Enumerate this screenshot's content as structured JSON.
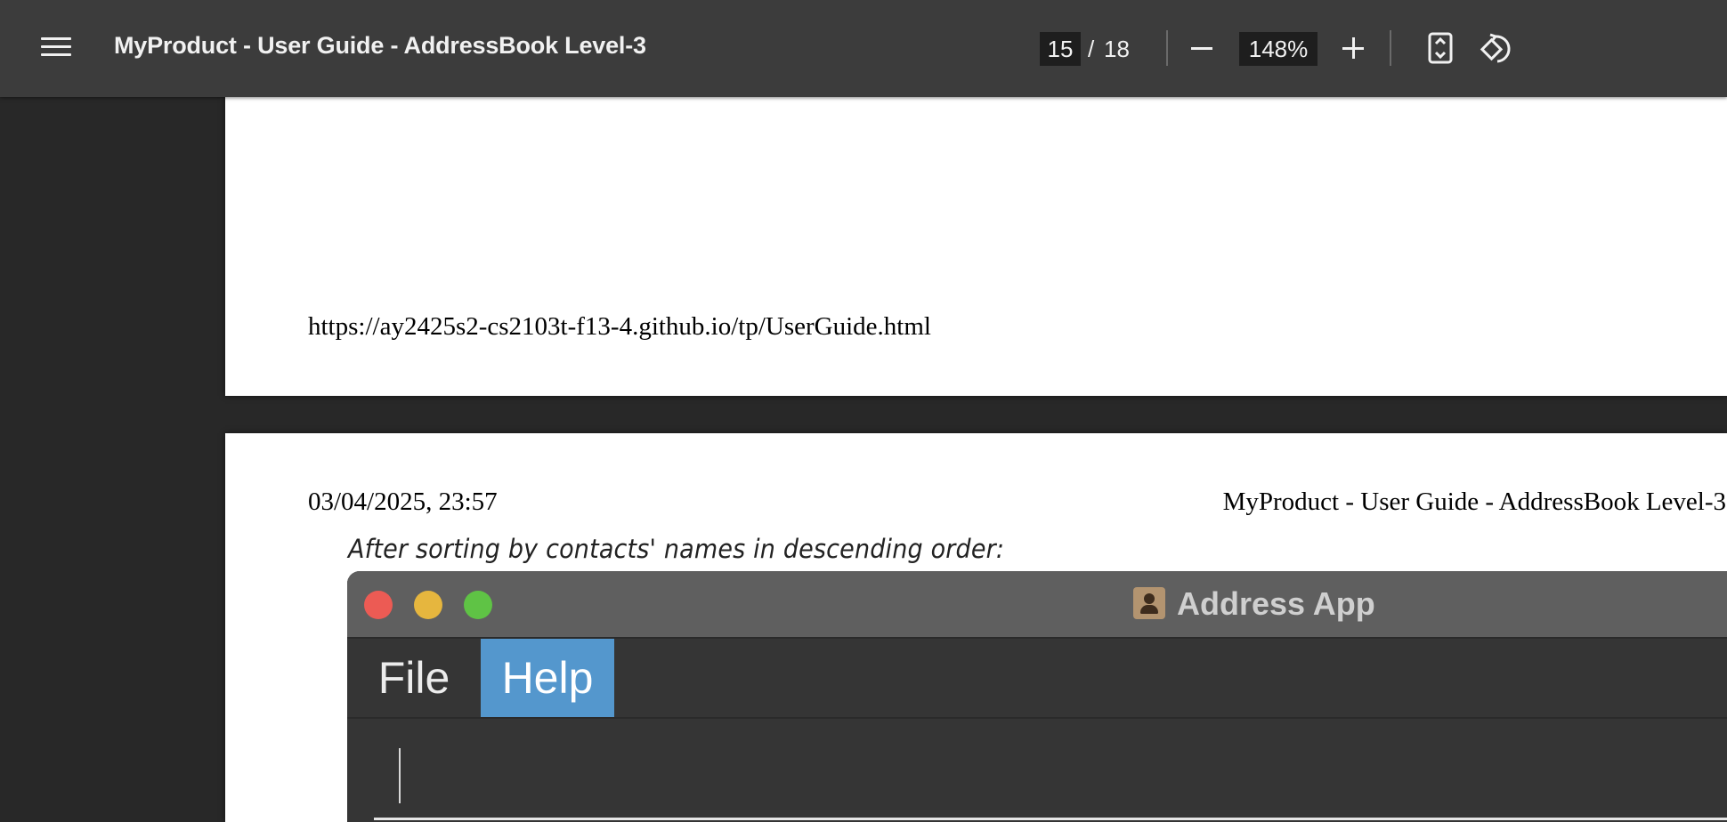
{
  "toolbar": {
    "menu_icon": "hamburger-menu-icon",
    "title": "MyProduct - User Guide - AddressBook Level-3",
    "current_page": "15",
    "page_separator": "/",
    "total_pages": "18",
    "zoom_level": "148%",
    "zoom_out_icon": "minus-icon",
    "zoom_in_icon": "plus-icon",
    "fit_icon": "fit-to-page-icon",
    "rotate_icon": "rotate-icon"
  },
  "page1": {
    "footer_url": "https://ay2425s2-cs2103t-f13-4.github.io/tp/UserGuide.html"
  },
  "page2": {
    "header_date": "03/04/2025, 23:57",
    "header_title": "MyProduct - User Guide - AddressBook Level-3",
    "caption": "After sorting by contacts' names in descending order:",
    "app": {
      "window_title": "Address App",
      "menu": [
        "File",
        "Help"
      ],
      "highlighted_menu": "Help",
      "accent_color": "#5497cd"
    }
  }
}
